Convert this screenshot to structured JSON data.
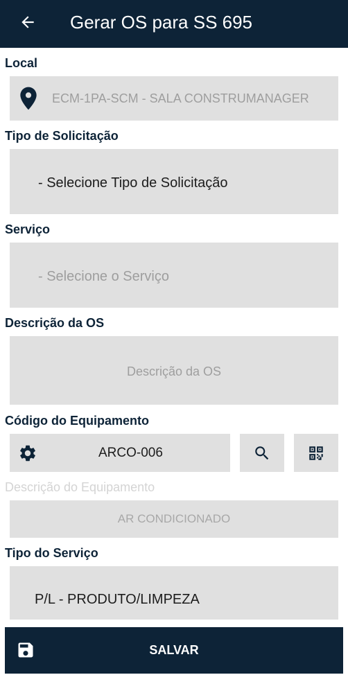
{
  "header": {
    "title": "Gerar OS para SS 695",
    "back_icon": "arrow-left-icon"
  },
  "local": {
    "label": "Local",
    "value": "ECM-1PA-SCM - SALA CONSTRUMANAGER",
    "icon": "location-pin-icon"
  },
  "tipo_solicitacao": {
    "label": "Tipo de Solicitação",
    "value": "- Selecione Tipo de Solicitação"
  },
  "servico": {
    "label": "Serviço",
    "placeholder": "- Selecione o Serviço"
  },
  "descricao_os": {
    "label": "Descrição da OS",
    "placeholder": "Descrição da OS"
  },
  "codigo_equipamento": {
    "label": "Código do Equipamento",
    "value": "ARCO-006",
    "gear_icon": "gear-icon",
    "search_icon": "search-icon",
    "qr_icon": "qr-code-icon"
  },
  "descricao_equipamento": {
    "label": "Descrição do Equipamento",
    "value": "AR CONDICIONADO"
  },
  "tipo_servico": {
    "label": "Tipo do Serviço",
    "value": "P/L - PRODUTO/LIMPEZA"
  },
  "save_button": {
    "label": "SALVAR",
    "icon": "floppy-disk-icon"
  },
  "colors": {
    "primary": "#0d2337",
    "field_bg": "#e0e0e0"
  }
}
